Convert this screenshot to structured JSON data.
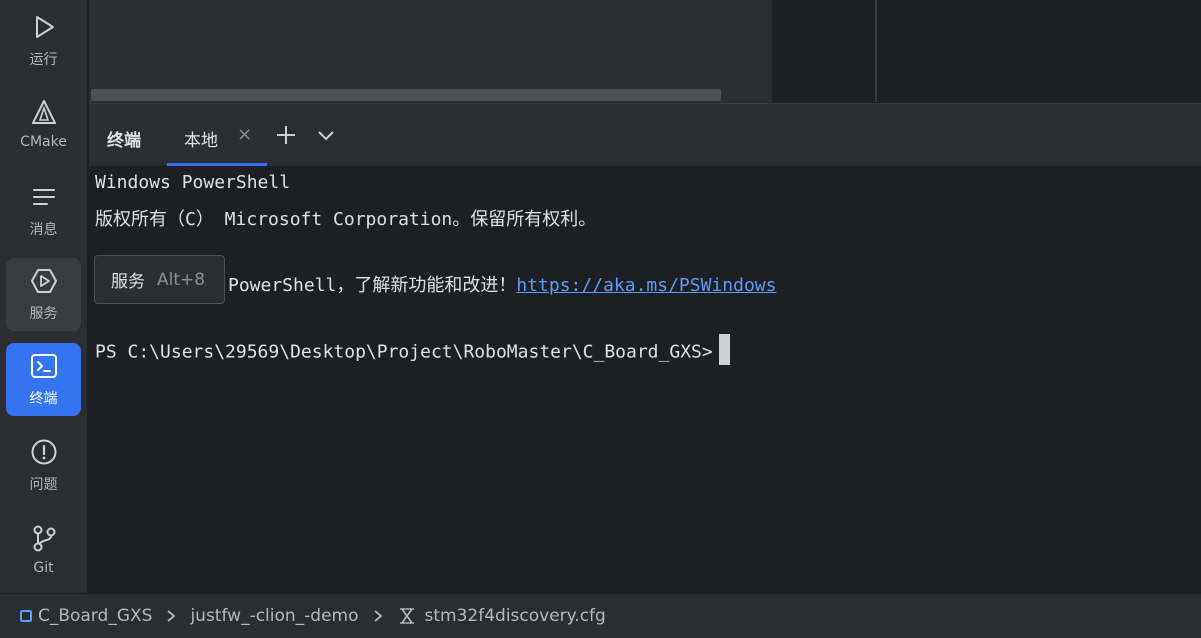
{
  "sidebar": {
    "items": [
      {
        "label": "运行",
        "icon": "play-icon"
      },
      {
        "label": "CMake",
        "icon": "cmake-icon"
      },
      {
        "label": "消息",
        "icon": "messages-icon"
      },
      {
        "label": "服务",
        "icon": "services-icon"
      },
      {
        "label": "终端",
        "icon": "terminal-icon"
      },
      {
        "label": "问题",
        "icon": "problems-icon"
      },
      {
        "label": "Git",
        "icon": "git-branch-icon"
      }
    ]
  },
  "terminal": {
    "title": "终端",
    "tab_label": "本地",
    "close_glyph": "×",
    "lines": {
      "l1": "Windows PowerShell",
      "l2": "版权所有（C） Microsoft Corporation。保留所有权利。",
      "l3_prefix": "PowerShell，了解新功能和改进！",
      "l3_link": "https://aka.ms/PSWindows",
      "prompt": "PS C:\\Users\\29569\\Desktop\\Project\\RoboMaster\\C_Board_GXS>"
    }
  },
  "tooltip": {
    "name": "服务",
    "shortcut": "Alt+8"
  },
  "breadcrumb": {
    "items": [
      "C_Board_GXS",
      "justfw_-clion_-demo",
      "stm32f4discovery.cfg"
    ]
  },
  "colors": {
    "accent": "#3574f0",
    "link": "#5c9cff",
    "panel": "#2b2d30",
    "background": "#1e1f22"
  }
}
